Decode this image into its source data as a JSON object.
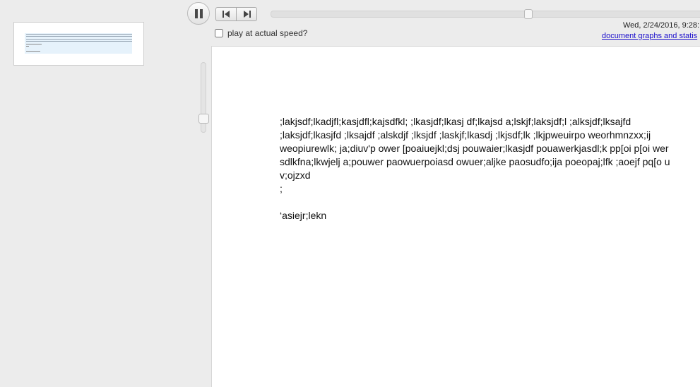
{
  "player": {
    "speed_label": "play at actual speed?",
    "speed_checked": false,
    "progress": 0.59,
    "zoom": 0.86
  },
  "header": {
    "timestamp": "Wed, 2/24/2016, 9:28:",
    "stats_link": "document graphs and statis"
  },
  "document": {
    "lines": [
      ";lakjsdf;lkadjfl;kasjdfl;kajsdfkl; ;lkasjdf;lkasj df;lkajsd a;lskjf;laksjdf;l ;alksjdf;lksajfd",
      ";laksjdf;lkasjfd ;lksajdf ;alskdjf ;lksjdf ;laskjf;lkasdj ;lkjsdf;lk ;lkjpweuirpo weorhmnzxx;ij",
      "weopiurewlk; ja;diuv'p ower [poaiuejkl;dsj pouwaier;lkasjdf pouawerkjasdl;k pp[oi p[oi wer",
      "sdlkfna;lkwjelj a;pouwer paowuerpoiasd owuer;aljke paosudfo;ija poeopaj;lfk ;aoejf pq[o u",
      "v;ojzxd",
      ";",
      "",
      "‘asiejr;lekn"
    ]
  },
  "colors": {
    "background": "#ececec",
    "link": "#1a0dcc",
    "highlight": "#e6f2fb"
  },
  "icons": {
    "pause": "pause-icon",
    "step_back": "step-back-icon",
    "step_forward": "step-forward-icon"
  }
}
